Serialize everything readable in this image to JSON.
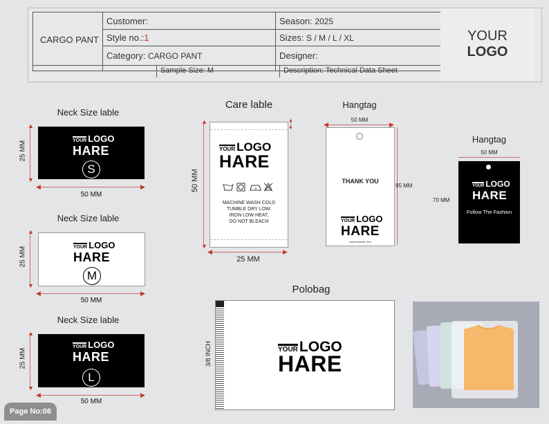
{
  "header": {
    "product": "CARGO PANT",
    "customer_label": "Customer:",
    "style_label": "Style no.:",
    "style_value": "1",
    "category_label": "Category:",
    "category_value": "CARGO PANT",
    "season_label": "Season:",
    "season_value": "2025",
    "sizes_label": "Sizes:",
    "sizes_value": "S / M / L / XL",
    "designer_label": "Designer:",
    "sample_size": "Sample Size:  M",
    "description": "Description: Technical Data Sheet",
    "logo_line1": "YOUR",
    "logo_line2": "LOGO"
  },
  "brand": {
    "small": "YOUR",
    "big": "LOGO",
    "name": "HARE"
  },
  "neck_labels": [
    {
      "title": "Neck Size lable",
      "size": "S",
      "height": "25 MM",
      "width": "50 MM"
    },
    {
      "title": "Neck Size lable",
      "size": "M",
      "height": "25 MM",
      "width": "50 MM"
    },
    {
      "title": "Neck Size lable",
      "size": "L",
      "height": "25 MM",
      "width": "50 MM"
    }
  ],
  "care_label": {
    "title": "Care lable",
    "height": "50 MM",
    "width": "25 MM",
    "text": [
      "MACHINE WASH COLD",
      "TUMBLE DRY LOW,",
      "IRON LOW HEAT,",
      "DO NOT BLEACH"
    ]
  },
  "hangtag_white": {
    "title": "Hangtag",
    "width": "50 MM",
    "height": "95 MM",
    "message": "THANK YOU",
    "footer": "www.website.com"
  },
  "hangtag_black": {
    "title": "Hangtag",
    "width": "50 MM",
    "height": "70 MM",
    "message": "Follow The Fashion"
  },
  "polobag": {
    "title": "Polobag",
    "dimension": "3/8 INCH"
  },
  "page_no": "Page No:06",
  "colors": {
    "background": "#e4e5e7",
    "label_black": "#000000",
    "dimension_red": "#c0392b",
    "shirt_orange": "#f3a23a"
  }
}
